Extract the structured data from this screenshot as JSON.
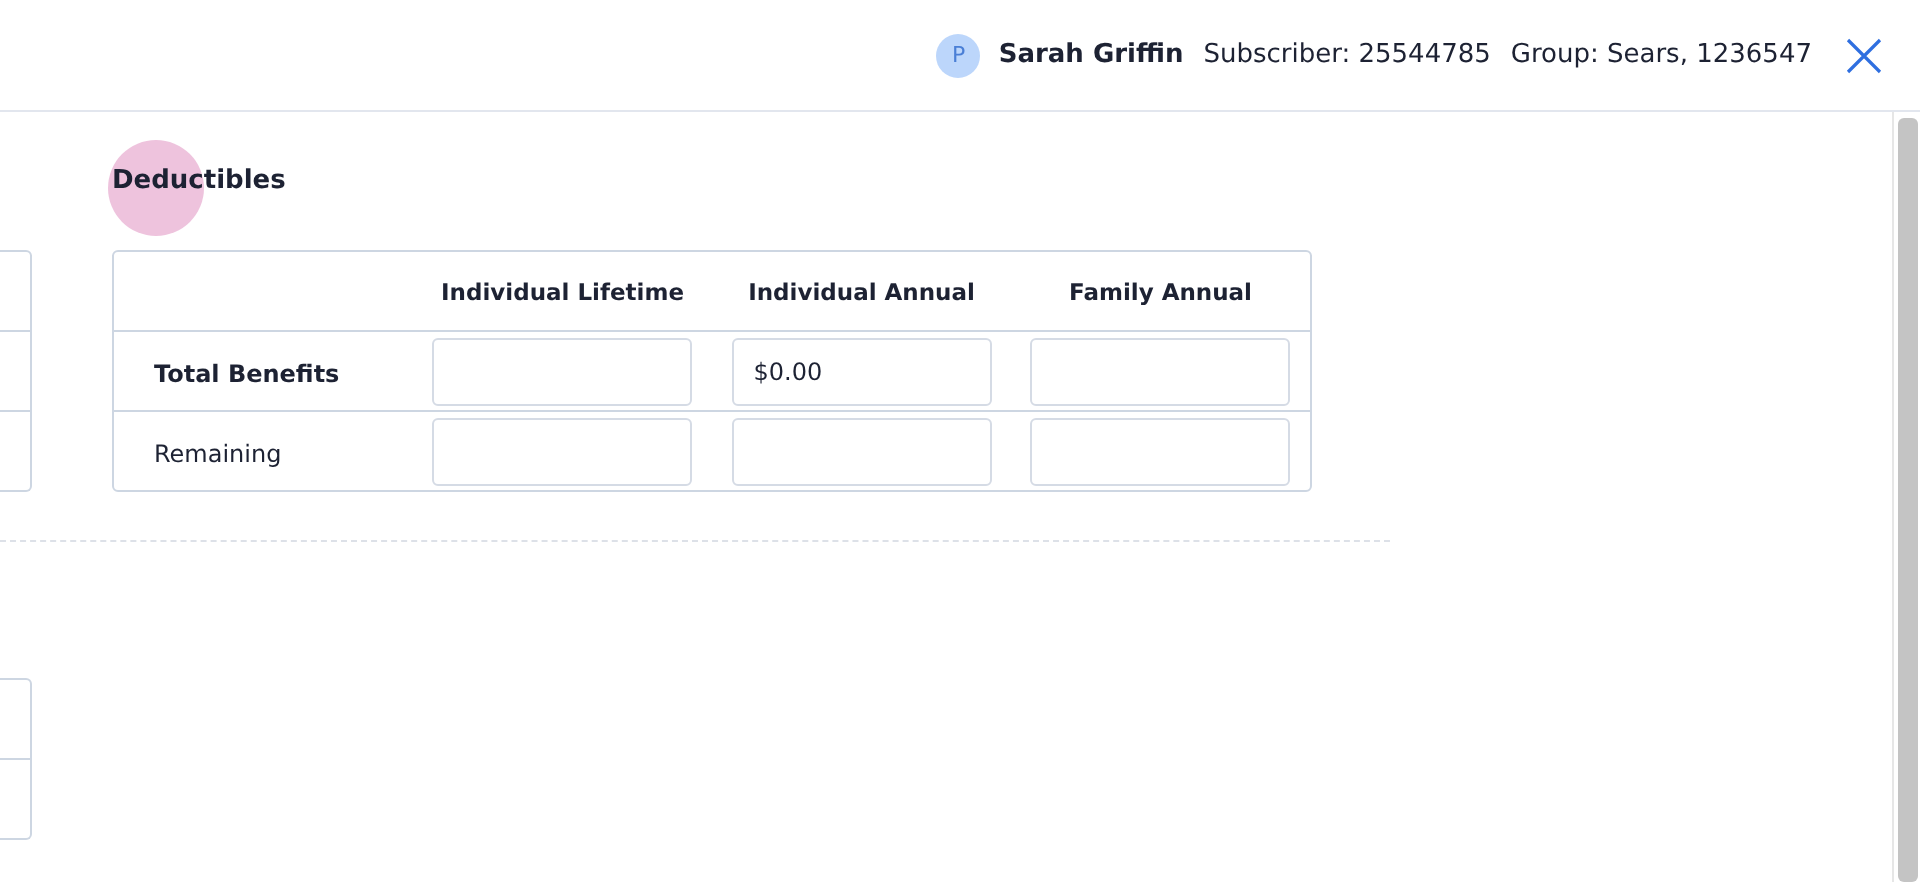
{
  "header": {
    "avatar_initial": "P",
    "name": "Sarah Griffin",
    "subscriber": "Subscriber: 25544785",
    "group": "Group: Sears, 1236547"
  },
  "deductibles": {
    "title": "Deductibles",
    "columns": [
      "Individual Lifetime",
      "Individual Annual",
      "Family Annual"
    ],
    "rows": [
      {
        "label": "Total Benefits",
        "emphasized": true,
        "fields": [
          {
            "kind": "blank"
          },
          {
            "kind": "amount",
            "value": "$0.00"
          },
          {
            "kind": "blank"
          }
        ]
      },
      {
        "label": "Remaining",
        "emphasized": false,
        "fields": [
          {
            "kind": "blank"
          },
          {
            "kind": "blank"
          },
          {
            "kind": "blank"
          }
        ]
      }
    ]
  }
}
